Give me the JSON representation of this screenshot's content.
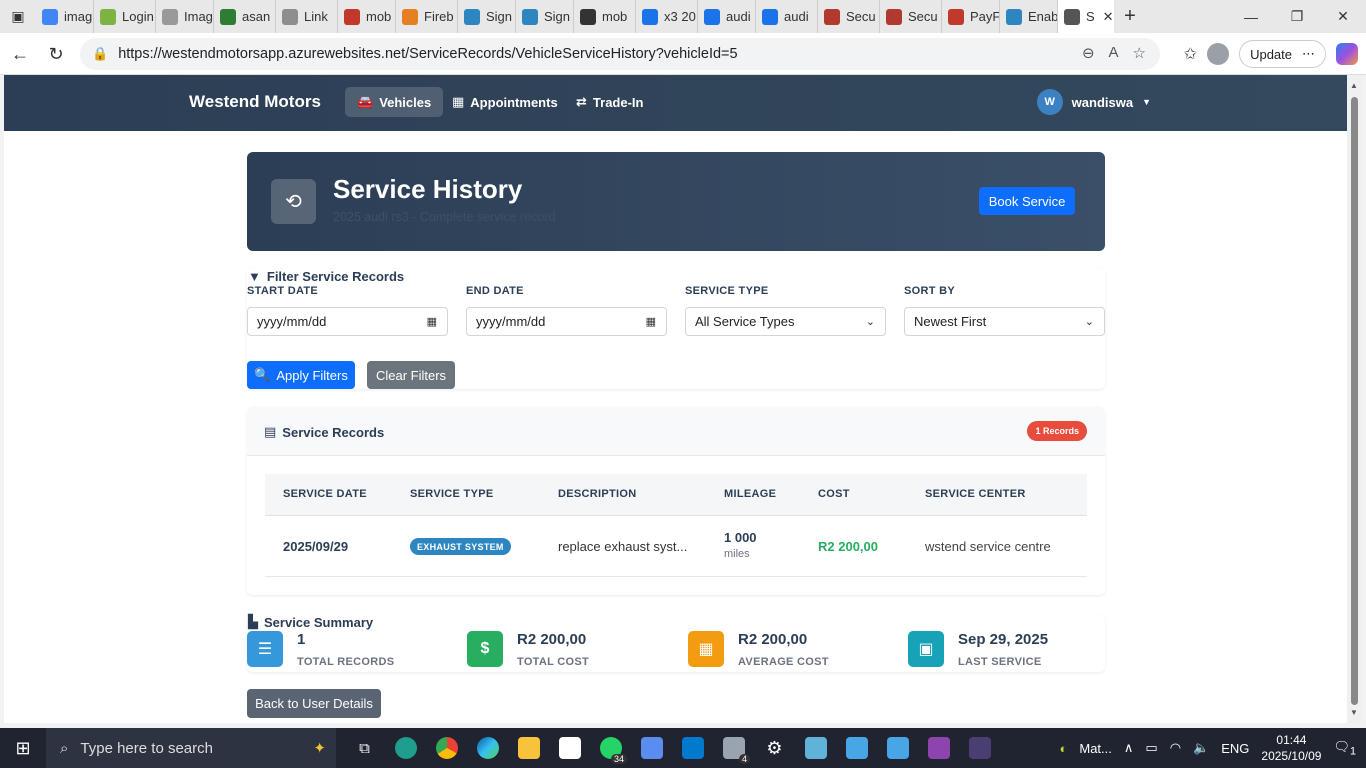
{
  "browser": {
    "tabs": [
      {
        "label": "imag",
        "color": "#4285f4"
      },
      {
        "label": "Login",
        "color": "#7cb342"
      },
      {
        "label": "Imag",
        "color": "#999999"
      },
      {
        "label": "asan",
        "color": "#2e7d32"
      },
      {
        "label": "Link",
        "color": "#8e8e8e"
      },
      {
        "label": "mob",
        "color": "#c0392b"
      },
      {
        "label": "Fireb",
        "color": "#e67e22"
      },
      {
        "label": "Sign",
        "color": "#2e86c1"
      },
      {
        "label": "Sign",
        "color": "#2e86c1"
      },
      {
        "label": "mob",
        "color": "#333333"
      },
      {
        "label": "x3 20",
        "color": "#1a73e8"
      },
      {
        "label": "audi",
        "color": "#1a73e8"
      },
      {
        "label": "audi",
        "color": "#1a73e8"
      },
      {
        "label": "Secu",
        "color": "#b03a2e"
      },
      {
        "label": "Secu",
        "color": "#b03a2e"
      },
      {
        "label": "PayF",
        "color": "#c0392b"
      },
      {
        "label": "Enab",
        "color": "#2e86c1"
      },
      {
        "label": "S",
        "color": "#555555"
      }
    ],
    "url": "https://westendmotorsapp.azurewebsites.net/ServiceRecords/VehicleServiceHistory?vehicleId=5",
    "update_label": "Update"
  },
  "app": {
    "brand": "Westend Motors",
    "nav": {
      "vehicles": "Vehicles",
      "appointments": "Appointments",
      "tradein": "Trade-In"
    },
    "user": {
      "initial": "W",
      "name": "wandiswa"
    }
  },
  "hero": {
    "title": "Service History",
    "subtitle": "2025 audi rs3 - Complete service record",
    "book_button": "Book Service"
  },
  "filter": {
    "title": "Filter Service Records",
    "start_label": "START DATE",
    "start_value": "yyyy/mm/dd",
    "end_label": "END DATE",
    "end_value": "yyyy/mm/dd",
    "type_label": "SERVICE TYPE",
    "type_value": "All Service Types",
    "sort_label": "SORT BY",
    "sort_value": "Newest First",
    "apply_button": "Apply Filters",
    "clear_button": "Clear Filters"
  },
  "records": {
    "title": "Service Records",
    "count_badge": "1 Records",
    "columns": [
      "SERVICE DATE",
      "SERVICE TYPE",
      "DESCRIPTION",
      "MILEAGE",
      "COST",
      "SERVICE CENTER"
    ],
    "rows": [
      {
        "date": "2025/09/29",
        "type": "EXHAUST SYSTEM",
        "description": "replace exhaust syst...",
        "mileage": "1 000",
        "mileage_unit": "miles",
        "cost": "R2 200,00",
        "center": "wstend service centre"
      }
    ]
  },
  "summary": {
    "title": "Service Summary",
    "stats": [
      {
        "value": "1",
        "label": "TOTAL RECORDS",
        "color": "#3498db",
        "icon": "list-icon"
      },
      {
        "value": "R2 200,00",
        "label": "TOTAL COST",
        "color": "#27ae60",
        "icon": "dollar-icon"
      },
      {
        "value": "R2 200,00",
        "label": "AVERAGE COST",
        "color": "#f39c12",
        "icon": "calculator-icon"
      },
      {
        "value": "Sep 29, 2025",
        "label": "LAST SERVICE",
        "color": "#17a2b8",
        "icon": "calendar-icon"
      }
    ]
  },
  "back_button": "Back to User Details",
  "taskbar": {
    "search_placeholder": "Type here to search",
    "whatsapp_count": "34",
    "app_count": "4",
    "mat_label": "Mat...",
    "lang": "ENG",
    "time": "01:44",
    "date": "2025/10/09",
    "notif_count": "1"
  }
}
